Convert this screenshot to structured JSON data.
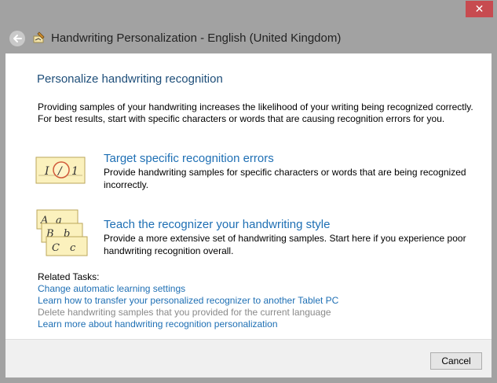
{
  "window": {
    "title": "Handwriting Personalization - English (United Kingdom)",
    "close_glyph": "✕"
  },
  "content": {
    "heading": "Personalize handwriting recognition",
    "intro": "Providing samples of your handwriting increases the likelihood of your writing being recognized correctly. For best results, start with specific characters or words that are causing recognition errors for you.",
    "options": [
      {
        "title": "Target specific recognition errors",
        "description": "Provide handwriting samples for specific characters or words that are being recognized incorrectly.",
        "icon": "recognition-errors-icon"
      },
      {
        "title": "Teach the recognizer your handwriting style",
        "description": "Provide a more extensive set of handwriting samples. Start here if you experience poor handwriting recognition overall.",
        "icon": "handwriting-style-icon"
      }
    ],
    "related_tasks_label": "Related Tasks:",
    "related_links": [
      {
        "label": "Change automatic learning settings",
        "enabled": true
      },
      {
        "label": "Learn how to transfer your personalized recognizer to another Tablet PC",
        "enabled": true
      },
      {
        "label": "Delete handwriting samples that you provided for the current language",
        "enabled": false
      },
      {
        "label": "Learn more about handwriting recognition personalization",
        "enabled": true
      }
    ]
  },
  "footer": {
    "cancel_label": "Cancel"
  }
}
